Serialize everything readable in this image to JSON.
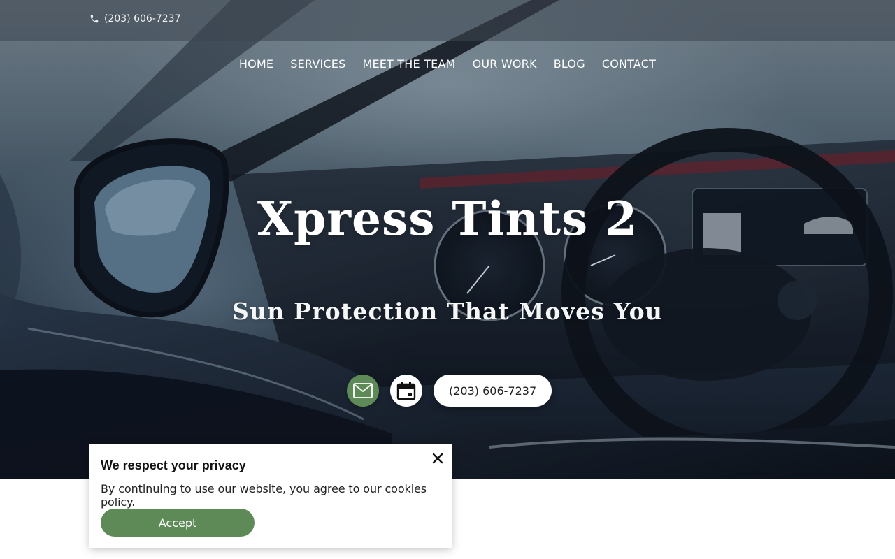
{
  "topbar": {
    "phone": "(203) 606-7237",
    "phone_icon": "phone-icon"
  },
  "nav": {
    "items": [
      {
        "label": "HOME"
      },
      {
        "label": "SERVICES"
      },
      {
        "label": "MEET THE TEAM"
      },
      {
        "label": "OUR WORK"
      },
      {
        "label": "BLOG"
      },
      {
        "label": "CONTACT"
      }
    ]
  },
  "hero": {
    "title": "Xpress Tints 2",
    "subtitle": "Sun Protection That Moves You",
    "image": "car-interior-photo",
    "cta": {
      "mail_icon": "mail-icon",
      "calendar_icon": "calendar-icon",
      "phone_label": "(203) 606-7237"
    }
  },
  "cookie_banner": {
    "title": "We respect your privacy",
    "text": "By continuing to use our website, you agree to our cookies policy.",
    "accept_label": "Accept",
    "close_icon": "close-icon"
  },
  "colors": {
    "accent": "#5e8a57",
    "topbar_bg": "#3c4650",
    "white": "#ffffff"
  }
}
